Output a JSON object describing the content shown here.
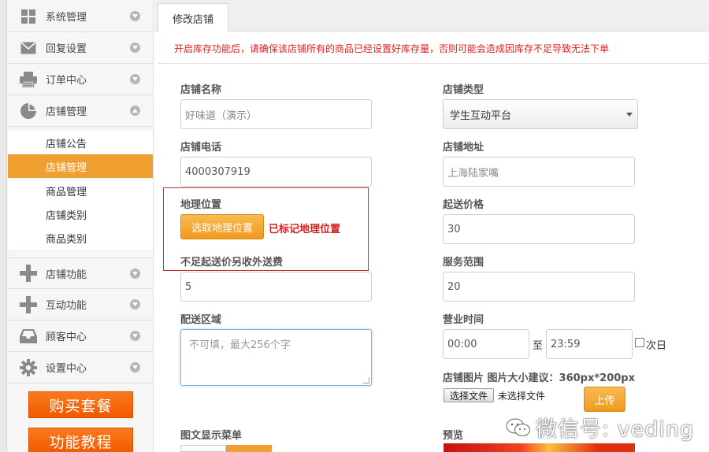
{
  "sidebar": {
    "top_items": [
      {
        "label": "系统管理",
        "icon": "grid-icon"
      },
      {
        "label": "回复设置",
        "icon": "envelope-icon"
      },
      {
        "label": "订单中心",
        "icon": "printer-icon"
      },
      {
        "label": "店铺管理",
        "icon": "pie-chart-icon"
      }
    ],
    "sub_items": [
      {
        "label": "店铺公告"
      },
      {
        "label": "店铺管理",
        "active": true
      },
      {
        "label": "商品管理"
      },
      {
        "label": "店铺类别"
      },
      {
        "label": "商品类别"
      }
    ],
    "bottom_items": [
      {
        "label": "店铺功能",
        "icon": "plus-icon"
      },
      {
        "label": "互动功能",
        "icon": "plus-icon"
      },
      {
        "label": "顾客中心",
        "icon": "inbox-icon"
      },
      {
        "label": "设置中心",
        "icon": "gear-icon"
      }
    ],
    "buy_button": "购买套餐",
    "tutorial_button": "功能教程"
  },
  "tab": {
    "label": "修改店铺"
  },
  "warning": "开启库存功能后，请确保该店铺所有的商品已经设置好库存量，否则可能会造成因库存不足导致无法下单",
  "form": {
    "shop_name": {
      "label": "店铺名称",
      "placeholder": "好味道（演示）"
    },
    "shop_type": {
      "label": "店铺类型",
      "value": "学生互动平台"
    },
    "shop_phone": {
      "label": "店铺电话",
      "value": "4000307919"
    },
    "shop_address": {
      "label": "店铺地址",
      "placeholder": "上海陆家嘴"
    },
    "geo": {
      "label": "地理位置",
      "button": "选取地理位置",
      "status": "已标记地理位置"
    },
    "min_price": {
      "label": "起送价格",
      "value": "30"
    },
    "extra_fee": {
      "label": "不足起送价另收外送费",
      "value": "5"
    },
    "service_range": {
      "label": "服务范围",
      "value": "20"
    },
    "delivery_area": {
      "label": "配送区域",
      "placeholder": "不可填，最大256个字"
    },
    "business_hours": {
      "label": "营业时间",
      "start": "00:00",
      "to": "至",
      "end": "23:59",
      "next_day": "次日"
    },
    "shop_image": {
      "label": "店铺图片  图片大小建议：360px*200px",
      "file_button": "选择文件",
      "file_status": "未选择文件",
      "upload": "上传"
    },
    "menu_display": {
      "label": "图文显示菜单"
    },
    "preview": {
      "label": "预览"
    }
  },
  "watermark": {
    "text": "微信号: veding"
  },
  "colors": {
    "accent": "#f0a030",
    "warning": "#e02020",
    "buy": "#f05a00"
  }
}
